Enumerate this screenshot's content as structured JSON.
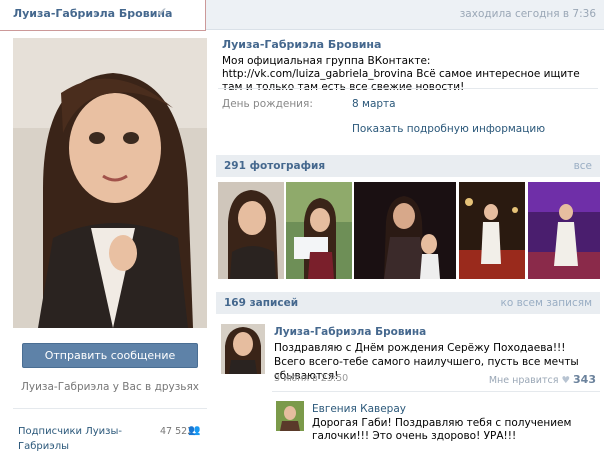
{
  "header": {
    "name": "Луиза-Габриэла Бровина",
    "verified_icon": "check-icon",
    "last_seen": "заходила сегодня в 7:36"
  },
  "left": {
    "send_message": "Отправить сообщение",
    "friend_note": "Луиза-Габриэла у Вас в друзьях",
    "subscribers_label": "Подписчики Луизы-Габриэлы",
    "subscribers_count": "47 522"
  },
  "profile": {
    "name": "Луиза-Габриэла Бровина",
    "status": "Моя официальная группа ВКонтакте: http://vk.com/luiza_gabriela_brovina Всё самое интересное ищите там и только там есть все свежие новости!",
    "birthday_label": "День рождения:",
    "birthday_value": "8 марта",
    "more_info": "Показать подробную информацию"
  },
  "photos": {
    "title": "291 фотография",
    "all": "все"
  },
  "wall": {
    "title": "169 записей",
    "all": "ко всем записям"
  },
  "post": {
    "author": "Луиза-Габриэла Бровина",
    "text": "Поздравляю с Днём рождения Серёжу Походаева!!! Всего всего-тебе самого наилучшего, пусть все мечты сбываются!",
    "date": "3 июня в 23:50",
    "likes_label": "Мне нравится",
    "likes_count": "343"
  },
  "comment": {
    "author": "Евгения Каверау",
    "text": "Дорогая Габи! Поздравляю тебя с получением галочки!!! Это очень здорово! УРА!!!"
  },
  "colors": {
    "link": "#45688e",
    "button": "#5e82a8",
    "header_bg": "#edf1f5"
  }
}
